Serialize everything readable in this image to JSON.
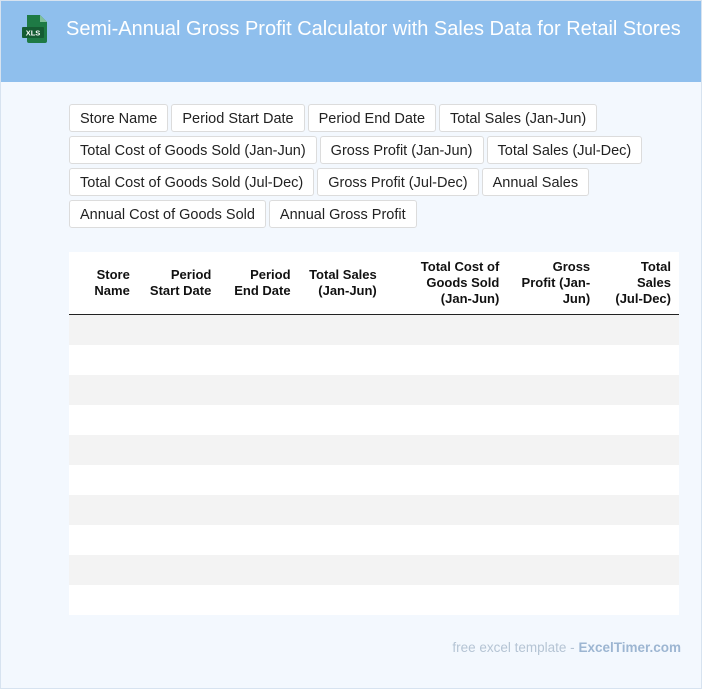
{
  "header": {
    "title": "Semi-Annual Gross Profit Calculator with Sales Data for Retail Stores",
    "icon_label": "XLS"
  },
  "fields": [
    "Store Name",
    "Period Start Date",
    "Period End Date",
    "Total Sales (Jan-Jun)",
    "Total Cost of Goods Sold (Jan-Jun)",
    "Gross Profit (Jan-Jun)",
    "Total Sales (Jul-Dec)",
    "Total Cost of Goods Sold (Jul-Dec)",
    "Gross Profit (Jul-Dec)",
    "Annual Sales",
    "Annual Cost of Goods Sold",
    "Annual Gross Profit"
  ],
  "table": {
    "columns": [
      "Store Name",
      "Period Start Date",
      "Period End Date",
      "Total Sales (Jan-Jun)",
      "Total Cost of Goods Sold (Jan-Jun)",
      "Gross Profit (Jan-Jun)",
      "Total Sales (Jul-Dec)"
    ],
    "row_count": 10
  },
  "footer": {
    "prefix": "free excel template - ",
    "brand": "ExcelTimer.com"
  },
  "colors": {
    "header_bg": "#8fbfed",
    "page_bg": "#f3f8fe",
    "icon_green": "#1e7a45",
    "row_stripe": "#f3f3f3"
  }
}
